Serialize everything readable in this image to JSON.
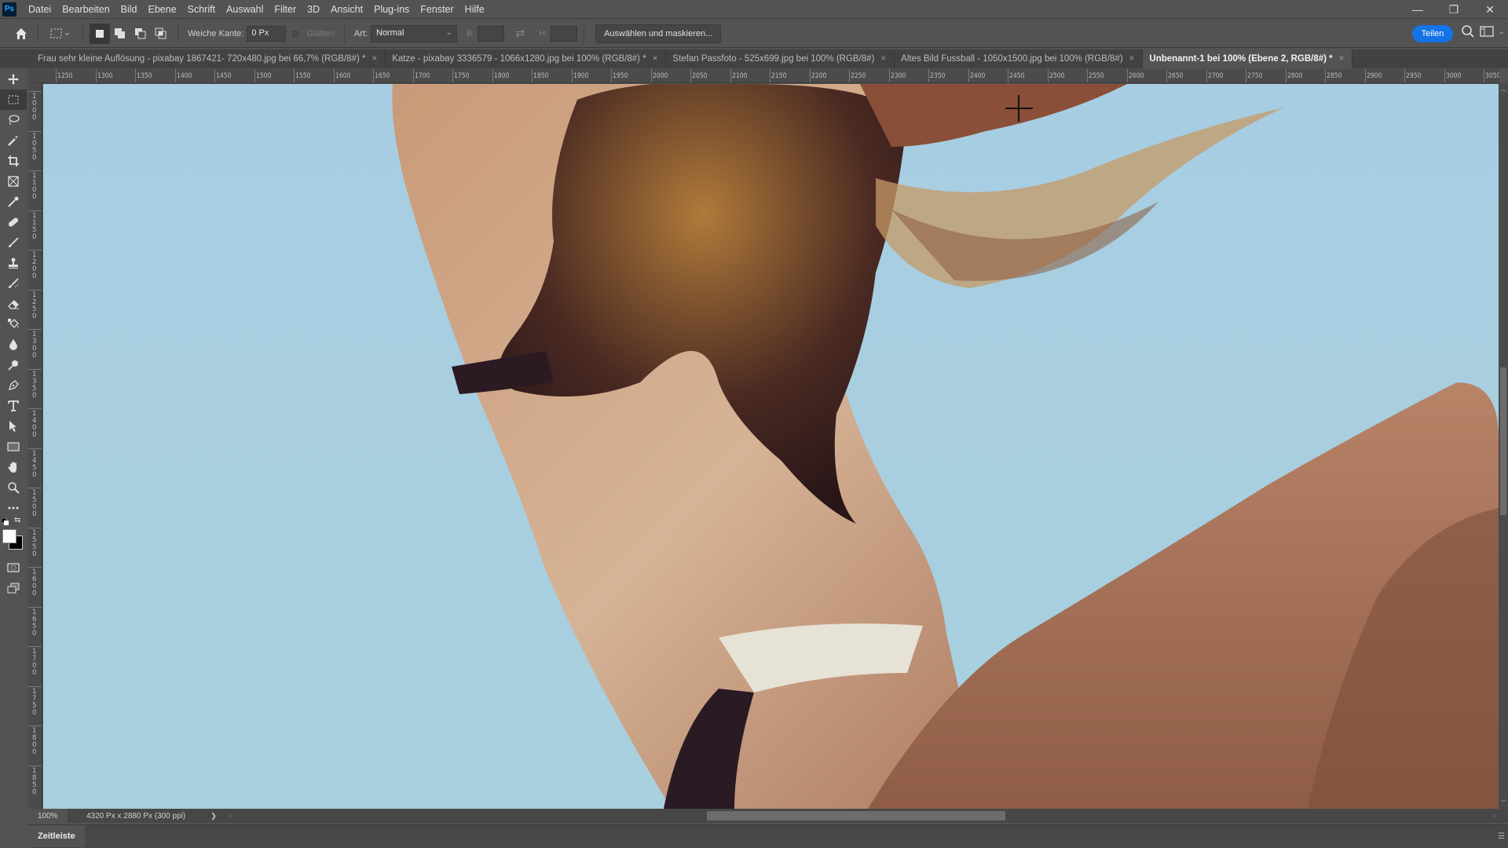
{
  "app": {
    "logo": "Ps",
    "menu": [
      "Datei",
      "Bearbeiten",
      "Bild",
      "Ebene",
      "Schrift",
      "Auswahl",
      "Filter",
      "3D",
      "Ansicht",
      "Plug-ins",
      "Fenster",
      "Hilfe"
    ],
    "window_controls": {
      "minimize": "—",
      "restore": "❐",
      "close": "✕"
    }
  },
  "options": {
    "feather_label": "Weiche Kante:",
    "feather_value": "0 Px",
    "antialias_label": "Glätten",
    "style_label": "Art:",
    "style_value": "Normal",
    "width_label": "B:",
    "width_value": "",
    "height_label": "H:",
    "height_value": "",
    "select_mask_button": "Auswählen und maskieren...",
    "share_button": "Teilen"
  },
  "tabs": [
    {
      "label": "Frau sehr kleine Auflösung - pixabay 1867421- 720x480.jpg bei 66,7% (RGB/8#) *",
      "active": false
    },
    {
      "label": "Katze - pixabay 3336579 - 1066x1280.jpg bei 100% (RGB/8#) *",
      "active": false
    },
    {
      "label": "Stefan Passfoto - 525x699.jpg bei 100% (RGB/8#)",
      "active": false
    },
    {
      "label": "Altes Bild Fussball - 1050x1500.jpg bei 100% (RGB/8#)",
      "active": false
    },
    {
      "label": "Unbenannt-1 bei 100% (Ebene 2, RGB/8#) *",
      "active": true
    }
  ],
  "tab_close_glyph": "×",
  "tools": [
    "move-tool",
    "rectangular-marquee-tool",
    "lasso-tool",
    "magic-wand-tool",
    "crop-tool",
    "frame-tool",
    "eyedropper-tool",
    "spot-healing-brush-tool",
    "brush-tool",
    "clone-stamp-tool",
    "history-brush-tool",
    "eraser-tool",
    "paint-bucket-tool",
    "blur-tool",
    "dodge-tool",
    "pen-tool",
    "type-tool",
    "path-selection-tool",
    "rectangle-tool",
    "hand-tool",
    "zoom-tool",
    "more-tools"
  ],
  "active_tool": "rectangular-marquee-tool",
  "colors": {
    "foreground": "#ffffff",
    "background": "#000000",
    "accent": "#1473e6"
  },
  "ruler_h": [
    "1250",
    "1300",
    "1350",
    "1400",
    "1450",
    "1500",
    "1550",
    "1600",
    "1650",
    "1700",
    "1750",
    "1800",
    "1850",
    "1900",
    "1950",
    "2000",
    "2050",
    "2100",
    "2150",
    "2200",
    "2250",
    "2300",
    "2350",
    "2400",
    "2450",
    "2500",
    "2550",
    "2600",
    "2650",
    "2700",
    "2750",
    "2800",
    "2850",
    "2900",
    "2950",
    "3000",
    "3050"
  ],
  "ruler_v": [
    "1000",
    "1050",
    "1100",
    "1150",
    "1200",
    "1250",
    "1300",
    "1350",
    "1400",
    "1450",
    "1500",
    "1550",
    "1600",
    "1650",
    "1700",
    "1750",
    "1800",
    "1850"
  ],
  "status": {
    "zoom": "100%",
    "doc_info": "4320 Px x 2880 Px (300 ppi)",
    "arrow": "❯"
  },
  "timeline": {
    "label": "Zeitleiste"
  }
}
